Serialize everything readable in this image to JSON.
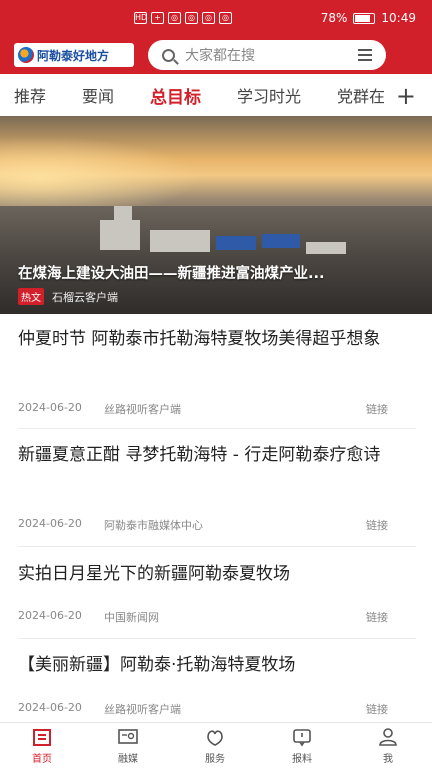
{
  "status_bar": {
    "left_icons": [
      "HD",
      "+",
      "◎",
      "◎",
      "◎",
      "◎"
    ],
    "battery": "78%",
    "time": "10:49"
  },
  "header": {
    "logo_text": "阿勒泰好地方",
    "search_placeholder": "大家都在搜"
  },
  "tabs": [
    {
      "label": "推荐",
      "active": false
    },
    {
      "label": "要闻",
      "active": false
    },
    {
      "label": "总目标",
      "active": true
    },
    {
      "label": "学习时光",
      "active": false
    },
    {
      "label": "党群在",
      "active": false
    }
  ],
  "tabs_more": "+",
  "hero": {
    "title": "在煤海上建设大油田——新疆推进富油煤产业...",
    "tag": "热文",
    "source": "石榴云客户端"
  },
  "news": [
    {
      "title": "仲夏时节 阿勒泰市托勒海特夏牧场美得超乎想象",
      "date": "2024-06-20",
      "source": "丝路视听客户端",
      "link": "链接"
    },
    {
      "title": "新疆夏意正酣 寻梦托勒海特 - 行走阿勒泰疗愈诗",
      "date": "2024-06-20",
      "source": "阿勒泰市融媒体中心",
      "link": "链接"
    },
    {
      "title": "实拍日月星光下的新疆阿勒泰夏牧场",
      "date": "2024-06-20",
      "source": "中国新闻网",
      "link": "链接"
    },
    {
      "title": "【美丽新疆】阿勒泰·托勒海特夏牧场",
      "date": "2024-06-20",
      "source": "丝路视听客户端",
      "link": "链接"
    }
  ],
  "bottom_nav": [
    {
      "label": "首页",
      "icon": "home-icon",
      "active": true
    },
    {
      "label": "融媒",
      "icon": "media-icon",
      "active": false
    },
    {
      "label": "服务",
      "icon": "service-icon",
      "active": false
    },
    {
      "label": "报料",
      "icon": "report-icon",
      "active": false
    },
    {
      "label": "我",
      "icon": "profile-icon",
      "active": false
    }
  ],
  "colors": {
    "brand": "#d2202a",
    "text": "#222222",
    "meta": "#888888"
  }
}
